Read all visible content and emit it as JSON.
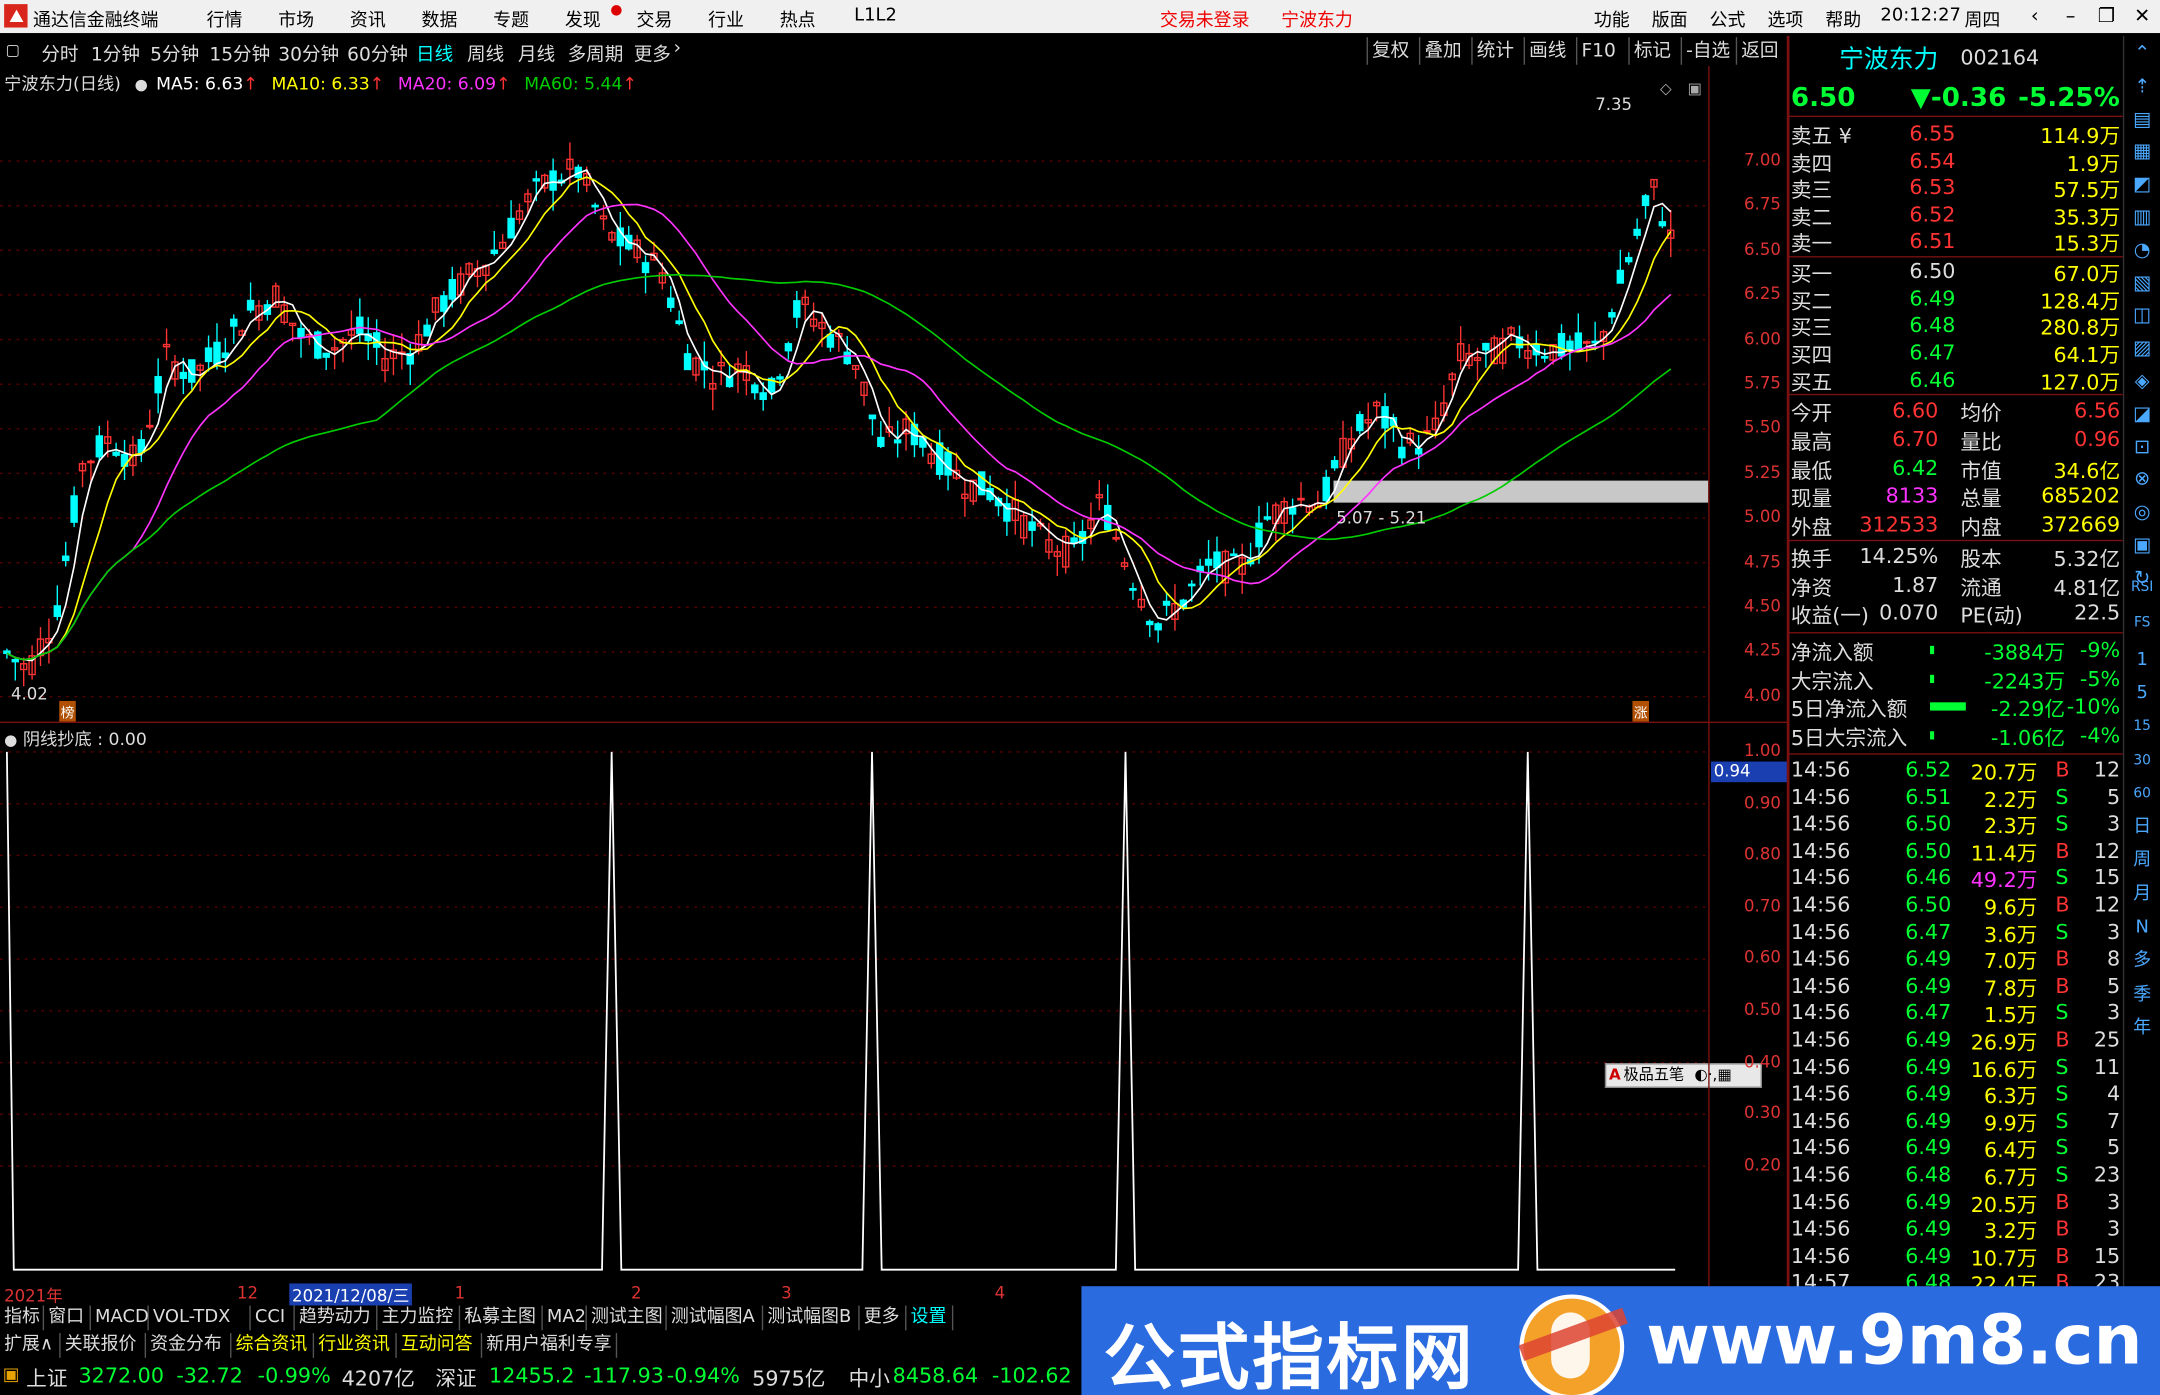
{
  "titlebar": {
    "app_name": "通达信金融终端",
    "menus": [
      "行情",
      "市场",
      "资讯",
      "数据",
      "专题",
      "发现",
      "交易",
      "行业",
      "热点",
      "L1L2"
    ],
    "login_status": "交易未登录",
    "stock_name": "宁波东力",
    "right_menus": [
      "功能",
      "版面",
      "公式",
      "选项",
      "帮助"
    ],
    "time": "20:12:27",
    "weekday": "周四"
  },
  "periods": [
    "分时",
    "1分钟",
    "5分钟",
    "15分钟",
    "30分钟",
    "60分钟",
    "日线",
    "周线",
    "月线",
    "多周期",
    "更多"
  ],
  "active_period": "日线",
  "chart_tools": [
    "复权",
    "叠加",
    "统计",
    "画线",
    "F10",
    "标记",
    "-自选",
    "返回"
  ],
  "ma_info": {
    "label": "宁波东力(日线)",
    "ma5": "MA5: 6.63",
    "ma10": "MA10: 6.33",
    "ma20": "MA20: 6.09",
    "ma60": "MA60: 5.44"
  },
  "colors": {
    "ma5": "#ffffff",
    "ma10": "#ffff00",
    "ma20": "#ff33ff",
    "ma60": "#00cc00",
    "up": "#ff3333",
    "down": "#00ffff"
  },
  "main_axis": [
    "7.00",
    "6.75",
    "6.50",
    "6.25",
    "6.00",
    "5.75",
    "5.50",
    "5.25",
    "5.00",
    "4.75",
    "4.50",
    "4.25",
    "4.00"
  ],
  "annotations": {
    "high": "7.35",
    "low": "4.02",
    "range": "5.07 - 5.21",
    "bang": "榜",
    "zhang": "涨"
  },
  "indicator": {
    "label": "阴线抄底 : 0.00",
    "axis": [
      "1.00",
      "0.90",
      "0.80",
      "0.70",
      "0.60",
      "0.50",
      "0.40",
      "0.30",
      "0.20"
    ],
    "current": "0.94"
  },
  "chart_data": {
    "type": "line",
    "dates": [
      "2021年",
      "12",
      "2021/12/08/三",
      "1",
      "2",
      "3",
      "4"
    ],
    "ylim": [
      4.0,
      7.4
    ],
    "indicator_ylim": [
      0,
      1
    ],
    "indicator_spikes": [
      1.0,
      1.0,
      1.0,
      1.0,
      1.0
    ]
  },
  "ime": {
    "label": "极品五笔"
  },
  "quote": {
    "name": "宁波东力",
    "code": "002164",
    "price": "6.50",
    "change": "▼-0.36",
    "pct": "-5.25%",
    "sells": [
      {
        "label": "卖五 ¥",
        "price": "6.55",
        "vol": "114.9万"
      },
      {
        "label": "卖四",
        "price": "6.54",
        "vol": "1.9万"
      },
      {
        "label": "卖三",
        "price": "6.53",
        "vol": "57.5万"
      },
      {
        "label": "卖二",
        "price": "6.52",
        "vol": "35.3万"
      },
      {
        "label": "卖一",
        "price": "6.51",
        "vol": "15.3万"
      }
    ],
    "buys": [
      {
        "label": "买一",
        "price": "6.50",
        "vol": "67.0万"
      },
      {
        "label": "买二",
        "price": "6.49",
        "vol": "128.4万"
      },
      {
        "label": "买三",
        "price": "6.48",
        "vol": "280.8万"
      },
      {
        "label": "买四",
        "price": "6.47",
        "vol": "64.1万"
      },
      {
        "label": "买五",
        "price": "6.46",
        "vol": "127.0万"
      }
    ],
    "stats": [
      {
        "l1": "今开",
        "v1": "6.60",
        "l2": "均价",
        "v2": "6.56"
      },
      {
        "l1": "最高",
        "v1": "6.70",
        "l2": "量比",
        "v2": "0.96"
      },
      {
        "l1": "最低",
        "v1": "6.42",
        "l2": "市值",
        "v2": "34.6亿"
      },
      {
        "l1": "现量",
        "v1": "8133",
        "l2": "总量",
        "v2": "685202"
      },
      {
        "l1": "外盘",
        "v1": "312533",
        "l2": "内盘",
        "v2": "372669"
      }
    ],
    "stats2": [
      {
        "l1": "换手",
        "v1": "14.25%",
        "l2": "股本",
        "v2": "5.32亿"
      },
      {
        "l1": "净资",
        "v1": "1.87",
        "l2": "流通",
        "v2": "4.81亿"
      },
      {
        "l1": "收益(一)",
        "v1": "0.070",
        "l2": "PE(动)",
        "v2": "22.5"
      }
    ],
    "flows": [
      {
        "label": "净流入额",
        "value": "-3884万",
        "pct": "-9%"
      },
      {
        "label": "大宗流入",
        "value": "-2243万",
        "pct": "-5%"
      },
      {
        "label": "5日净流入额",
        "value": "-2.29亿",
        "pct": "-10%"
      },
      {
        "label": "5日大宗流入",
        "value": "-1.06亿",
        "pct": "-4%"
      }
    ],
    "ticks": [
      [
        "14:56",
        "6.52",
        "20.7万",
        "B",
        "12"
      ],
      [
        "14:56",
        "6.51",
        "2.2万",
        "S",
        "5"
      ],
      [
        "14:56",
        "6.50",
        "2.3万",
        "S",
        "3"
      ],
      [
        "14:56",
        "6.50",
        "11.4万",
        "B",
        "12"
      ],
      [
        "14:56",
        "6.46",
        "49.2万",
        "S",
        "15"
      ],
      [
        "14:56",
        "6.50",
        "9.6万",
        "B",
        "12"
      ],
      [
        "14:56",
        "6.47",
        "3.6万",
        "S",
        "3"
      ],
      [
        "14:56",
        "6.49",
        "7.0万",
        "B",
        "8"
      ],
      [
        "14:56",
        "6.49",
        "7.8万",
        "B",
        "5"
      ],
      [
        "14:56",
        "6.47",
        "1.5万",
        "S",
        "3"
      ],
      [
        "14:56",
        "6.49",
        "26.9万",
        "B",
        "25"
      ],
      [
        "14:56",
        "6.49",
        "16.6万",
        "S",
        "11"
      ],
      [
        "14:56",
        "6.49",
        "6.3万",
        "S",
        "4"
      ],
      [
        "14:56",
        "6.49",
        "9.9万",
        "S",
        "7"
      ],
      [
        "14:56",
        "6.49",
        "6.4万",
        "S",
        "5"
      ],
      [
        "14:56",
        "6.48",
        "6.7万",
        "S",
        "23"
      ],
      [
        "14:56",
        "6.49",
        "20.5万",
        "B",
        "3"
      ],
      [
        "14:56",
        "6.49",
        "3.2万",
        "B",
        "3"
      ],
      [
        "14:56",
        "6.49",
        "10.7万",
        "B",
        "15"
      ],
      [
        "14:57",
        "6.48",
        "22.4万",
        "B",
        "23"
      ]
    ]
  },
  "sidebar_labels": [
    "RSI",
    "FS",
    "1",
    "5",
    "15",
    "30",
    "60",
    "日",
    "周",
    "月",
    "N",
    "多",
    "季",
    "年"
  ],
  "indicator_tabs": [
    "指标",
    "窗口",
    "MACD",
    "VOL-TDX",
    "CCI",
    "趋势动力",
    "主力监控",
    "私募主图",
    "MA2",
    "测试主图",
    "测试幅图A",
    "测试幅图B",
    "更多",
    "设置"
  ],
  "ext_tabs": [
    "扩展∧",
    "关联报价",
    "资金分布",
    "综合资讯",
    "行业资讯",
    "互动问答",
    "新用户福利专享"
  ],
  "index_bar": [
    {
      "name": "上证",
      "value": "3272.00",
      "change": "-32.72",
      "pct": "-0.99%",
      "amount": "4207亿"
    },
    {
      "name": "深证",
      "value": "12455.2",
      "change": "-117.93",
      "pct": "-0.94%",
      "amount": "5975亿"
    },
    {
      "name": "中小",
      "value": "8458.64",
      "change": "-102.62"
    }
  ],
  "watermark": {
    "cn": "公式指标网",
    "url": "www.9m8.cn"
  }
}
